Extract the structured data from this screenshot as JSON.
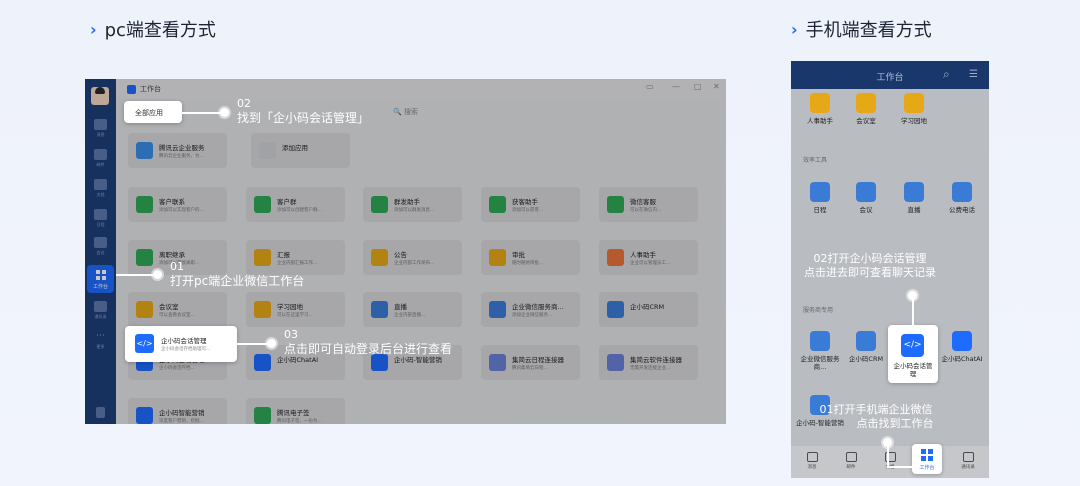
{
  "pc_title": "pc端查看方式",
  "mobile_title": "手机端查看方式",
  "chevron": "›",
  "pc": {
    "window_title": "工作台",
    "filter_all": "全部应用",
    "search": "🔍 搜索",
    "sidebar": [
      {
        "label": "消息"
      },
      {
        "label": "邮件"
      },
      {
        "label": "文档"
      },
      {
        "label": "日程"
      },
      {
        "label": "会议"
      },
      {
        "label": "通讯录"
      },
      {
        "label": "更多"
      }
    ],
    "workbench_label": "工作台",
    "top_apps": [
      {
        "name": "腾讯云企业服务",
        "desc": "腾讯云企业服务，为...",
        "color": "#3a8ee6"
      },
      {
        "name": "添加应用",
        "desc": "",
        "color": "#cfd0d4"
      }
    ],
    "apps": [
      {
        "name": "客户联系",
        "desc": "添加可以实现客户的...",
        "color": "#2fa855"
      },
      {
        "name": "客户群",
        "desc": "添加可以创建客户群...",
        "color": "#2fa855"
      },
      {
        "name": "群发助手",
        "desc": "添加可以群发消息...",
        "color": "#2fa855"
      },
      {
        "name": "获客助手",
        "desc": "添加可以获客...",
        "color": "#2fa855"
      },
      {
        "name": "微信客服",
        "desc": "可以在微信内...",
        "color": "#2fa855"
      },
      {
        "name": "离职继承",
        "desc": "添加可以转接离职...",
        "color": "#2fa855"
      },
      {
        "name": "汇报",
        "desc": "企业内部汇报工作...",
        "color": "#e6a817"
      },
      {
        "name": "公告",
        "desc": "企业内部工作发布...",
        "color": "#e6a817"
      },
      {
        "name": "审批",
        "desc": "随时随地审批...",
        "color": "#e6a817"
      },
      {
        "name": "人事助手",
        "desc": "企业可以管理员工...",
        "color": "#e8743b"
      },
      {
        "name": "会议室",
        "desc": "可以查看会议室...",
        "color": "#e6a817"
      },
      {
        "name": "学习园地",
        "desc": "可以在这里学习...",
        "color": "#e6a817"
      },
      {
        "name": "直播",
        "desc": "企业内部直播...",
        "color": "#3a7bd5"
      },
      {
        "name": "企业微信服务商...",
        "desc": "添加企业微信服务...",
        "color": "#3a7bd5"
      },
      {
        "name": "企小码CRM",
        "desc": "",
        "color": "#3a7bd5"
      },
      {
        "name": "企小码会话管理",
        "desc": "企小码会话存档...",
        "color": "#1e6bff"
      },
      {
        "name": "企小码ChatAI",
        "desc": "",
        "color": "#1e6bff"
      },
      {
        "name": "企小码-智能营销",
        "desc": "",
        "color": "#1e6bff"
      },
      {
        "name": "集简云日程连接器",
        "desc": "腾讯集简云日程...",
        "color": "#6b7fd7"
      },
      {
        "name": "集简云软件连接器",
        "desc": "无需开发连接企业...",
        "color": "#6b7fd7"
      },
      {
        "name": "企小码智能营销",
        "desc": "深度客户营销，挖掘...",
        "color": "#1e6bff"
      },
      {
        "name": "腾讯电子签",
        "desc": "腾讯电子签，一份为...",
        "color": "#2fa855"
      }
    ],
    "highlight_card": {
      "name": "企小码会话管理",
      "desc": "企小码会话存档助理可..."
    },
    "callouts": [
      {
        "num": "02",
        "text": "找到「企小码会话管理」"
      },
      {
        "num": "01",
        "text": "打开pc端企业微信工作台"
      },
      {
        "num": "03",
        "text": "点击即可自动登录后台进行查看"
      }
    ]
  },
  "mobile": {
    "header_title": "工作台",
    "row1": [
      {
        "name": "人事助手",
        "color": "#e6a817"
      },
      {
        "name": "会议室",
        "color": "#e6a817"
      },
      {
        "name": "学习园地",
        "color": "#e6a817"
      }
    ],
    "section_office": "效率工具",
    "row2": [
      {
        "name": "日程",
        "color": "#3a7bd5"
      },
      {
        "name": "会议",
        "color": "#3a7bd5"
      },
      {
        "name": "直播",
        "color": "#3a7bd5"
      },
      {
        "name": "公费电话",
        "color": "#3a7bd5"
      }
    ],
    "section_service": "服务商专用",
    "row3": [
      {
        "name": "企业微信服务商...",
        "color": "#3a7bd5"
      },
      {
        "name": "企小码CRM",
        "color": "#3a7bd5"
      },
      {
        "name": "企小码会话管理",
        "color": "#1e6bff"
      },
      {
        "name": "企小码ChatAI",
        "color": "#1e6bff"
      }
    ],
    "row4": [
      {
        "name": "企小码-智能营销",
        "color": "#3a7bd5"
      }
    ],
    "tabs": [
      {
        "name": "消息"
      },
      {
        "name": "邮件"
      },
      {
        "name": "文档"
      },
      {
        "name": "工作台"
      },
      {
        "name": "通讯录"
      }
    ],
    "callout_top": {
      "line1": "02打开企小码会话管理",
      "line2": "点击进去即可查看聊天记录"
    },
    "callout_bottom": {
      "line1": "01打开手机端企业微信",
      "line2": "点击找到工作台"
    }
  }
}
